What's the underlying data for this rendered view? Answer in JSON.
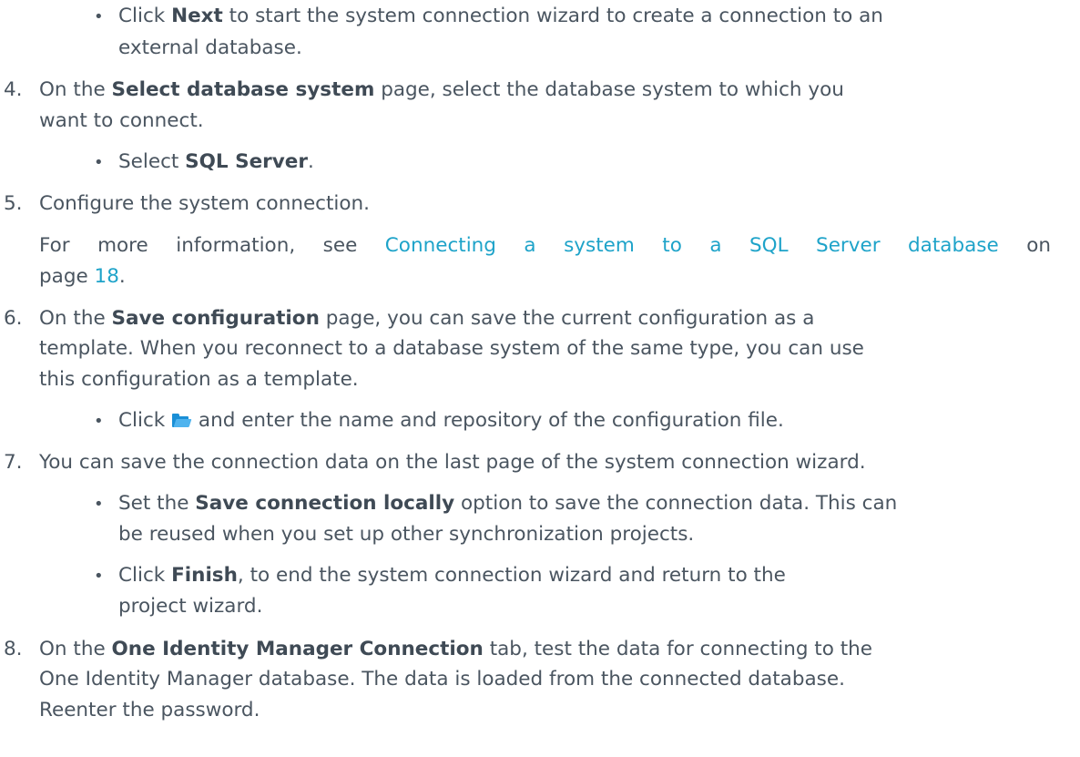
{
  "doc": {
    "step_top": {
      "bullet": {
        "pre": "Click ",
        "bold": "Next",
        "post_line1": " to start the system connection wizard to create a connection to an",
        "post_line2": "external database."
      }
    },
    "step4": {
      "number": "4.",
      "line1_pre": "On the ",
      "line1_bold": "Select database system",
      "line1_post": " page, select the database system to which you",
      "line2": "want to connect.",
      "bullet": {
        "pre": "Select ",
        "bold": "SQL Server",
        "post": "."
      }
    },
    "step5": {
      "number": "5.",
      "text": "Configure the system connection.",
      "info_pre": "For more information, see ",
      "info_link": "Connecting a system to a SQL Server database",
      "info_mid": " on",
      "info_page_pre": "page ",
      "info_page_link": "18",
      "info_page_post": "."
    },
    "step6": {
      "number": "6.",
      "line1_pre": "On the ",
      "line1_bold": "Save configuration",
      "line1_post": " page, you can save the current configuration as a",
      "line2": "template. When you reconnect to a database system of the same type, you can use",
      "line3": "this configuration as a template.",
      "bullet": {
        "pre": "Click ",
        "icon": "folder-open-icon",
        "post": " and enter the name and repository of the configuration file."
      }
    },
    "step7": {
      "number": "7.",
      "text": "You can save the connection data on the last page of the system connection wizard.",
      "bullet1": {
        "pre": "Set the ",
        "bold": "Save connection locally",
        "post": " option to save the connection data. This can",
        "line2": "be reused when you set up other synchronization projects."
      },
      "bullet2": {
        "pre": "Click ",
        "bold": "Finish",
        "post": ", to end the system connection wizard and return to the",
        "line2": "project wizard."
      }
    },
    "step8": {
      "number": "8.",
      "line1_pre": "On the ",
      "line1_bold": "One Identity Manager Connection",
      "line1_post": " tab, test the data for connecting to the",
      "line2": "One Identity Manager database. The data is loaded from the connected database.",
      "line3": "Reenter the password."
    },
    "colors": {
      "text": "#4a5560",
      "link": "#1ea3c9",
      "icon": "#1a8fd6"
    }
  }
}
